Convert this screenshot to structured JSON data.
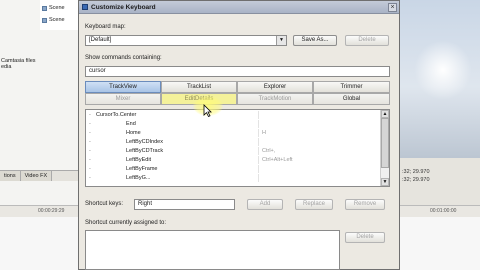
{
  "background": {
    "tree_items": [
      "Scene",
      "Scene"
    ],
    "side_list": [
      "Camtasia files",
      "edia"
    ],
    "tabs": [
      "tions",
      "Video FX"
    ],
    "ruler_timecode_left": "00:00:29:29",
    "ruler_timecode_right": "00:01:00:00",
    "timecode_1": ":32; 29.970",
    "timecode_2": ":32; 29.970"
  },
  "dialog": {
    "title": "Customize Keyboard",
    "keyboard_map_label": "Keyboard map:",
    "keyboard_map_value": "[Default]",
    "save_as_label": "Save As...",
    "delete_label": "Delete",
    "show_commands_label": "Show commands containing:",
    "search_value": "cursor",
    "tabs_row1": [
      "TrackView",
      "TrackList",
      "Explorer",
      "Trimmer"
    ],
    "tabs_row2": [
      "Mixer",
      "EditDetails",
      "TrackMotion",
      "Global"
    ],
    "commands": [
      {
        "name": "CursorTo.Center",
        "keys": ""
      },
      {
        "name": "End",
        "keys": ""
      },
      {
        "name": "Home",
        "keys": "H"
      },
      {
        "name": "LeftByCDIndex",
        "keys": ""
      },
      {
        "name": "LeftByCDTrack",
        "keys": "Ctrl+,"
      },
      {
        "name": "LeftByEdit",
        "keys": "Ctrl+Alt+Left"
      },
      {
        "name": "LeftByFrame",
        "keys": ""
      },
      {
        "name": "LeftByG...",
        "keys": ""
      }
    ],
    "shortcut_keys_label": "Shortcut keys:",
    "shortcut_value": "Right",
    "add_label": "Add",
    "replace_label": "Replace",
    "remove_label": "Remove",
    "assigned_label": "Shortcut currently assigned to:",
    "delete2_label": "Delete"
  }
}
